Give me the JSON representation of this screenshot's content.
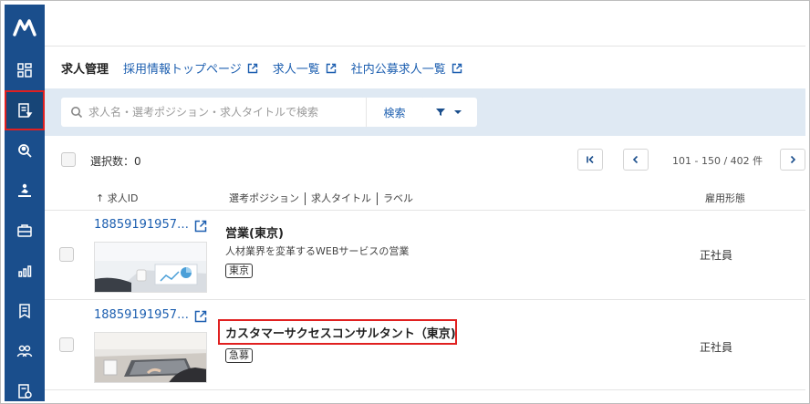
{
  "sidebar": {
    "logo": "M",
    "items": [
      {
        "name": "dashboard-icon"
      },
      {
        "name": "job-management-icon"
      },
      {
        "name": "candidate-search-icon"
      },
      {
        "name": "recruitment-icon"
      },
      {
        "name": "briefcase-icon"
      },
      {
        "name": "analytics-icon"
      },
      {
        "name": "document-icon"
      },
      {
        "name": "users-icon"
      },
      {
        "name": "settings-doc-icon"
      }
    ],
    "active_index": 1,
    "active_highlight_color": "#e02020"
  },
  "nav": {
    "title": "求人管理",
    "links": [
      "採用情報トップページ",
      "求人一覧",
      "社内公募求人一覧"
    ]
  },
  "search": {
    "placeholder": "求人名・選考ポジション・求人タイトルで検索",
    "button_label": "検索"
  },
  "selection": {
    "label": "選択数：0",
    "pagination_text": "101 - 150 / 402 件"
  },
  "table": {
    "headers": {
      "id": "↑ 求人ID",
      "position": "選考ポジション",
      "title": "求人タイトル",
      "label": "ラベル",
      "employment": "雇用形態"
    },
    "rows": [
      {
        "id": "18859191957…",
        "title": "営業(東京)",
        "subtitle": "人材業界を変革するWEBサービスの営業",
        "tag": "東京",
        "employment": "正社員"
      },
      {
        "id": "18859191957…",
        "title": "カスタマーサクセスコンサルタント（東京)",
        "subtitle": "",
        "tag": "急募",
        "employment": "正社員"
      }
    ]
  },
  "colors": {
    "sidebar": "#1a4e8c",
    "link": "#1d5fb0",
    "search_bg": "#dfe9f3",
    "highlight": "#e02020"
  }
}
